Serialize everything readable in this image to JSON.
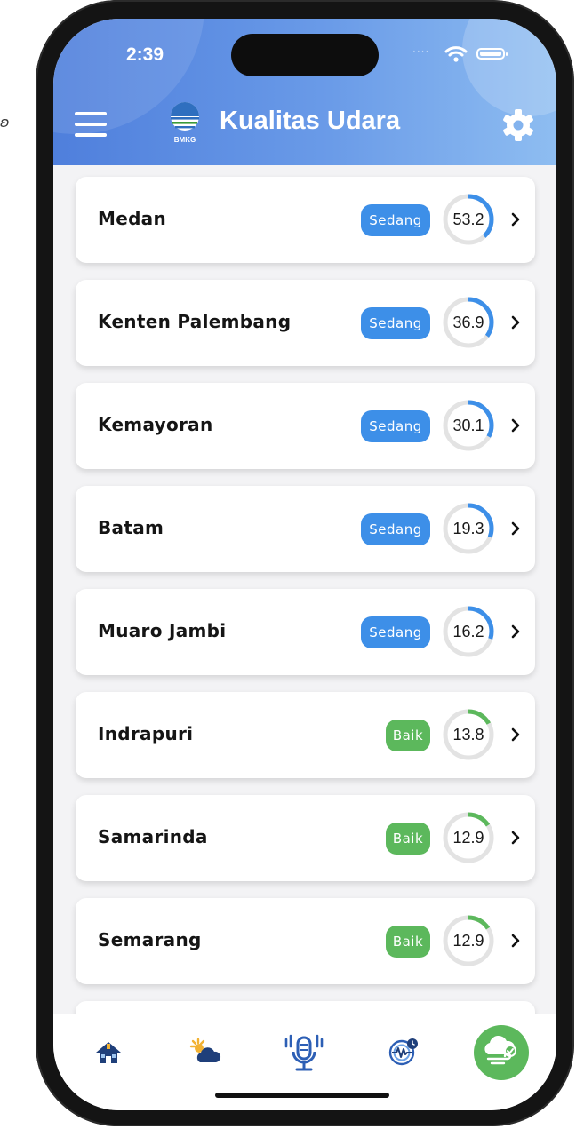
{
  "status_bar": {
    "time": "2:39"
  },
  "header": {
    "title": "Kualitas Udara",
    "logo_text": "BMKG"
  },
  "colors": {
    "sedang": "#3d8fe8",
    "baik": "#5cb85c",
    "ring_track": "#e3e3e3",
    "header_start": "#4f7fdc",
    "header_end": "#8ebdf1"
  },
  "stations": [
    {
      "name": "Medan",
      "status": "Sedang",
      "value": "53.2",
      "ring_fraction": 0.38
    },
    {
      "name": "Kenten Palembang",
      "status": "Sedang",
      "value": "36.9",
      "ring_fraction": 0.35
    },
    {
      "name": "Kemayoran",
      "status": "Sedang",
      "value": "30.1",
      "ring_fraction": 0.33
    },
    {
      "name": "Batam",
      "status": "Sedang",
      "value": "19.3",
      "ring_fraction": 0.31
    },
    {
      "name": "Muaro Jambi",
      "status": "Sedang",
      "value": "16.2",
      "ring_fraction": 0.3
    },
    {
      "name": "Indrapuri",
      "status": "Baik",
      "value": "13.8",
      "ring_fraction": 0.17
    },
    {
      "name": "Samarinda",
      "status": "Baik",
      "value": "12.9",
      "ring_fraction": 0.16
    },
    {
      "name": "Semarang",
      "status": "Baik",
      "value": "12.9",
      "ring_fraction": 0.16
    }
  ],
  "bottom_nav": [
    {
      "icon": "home-icon"
    },
    {
      "icon": "weather-icon"
    },
    {
      "icon": "microphone-icon"
    },
    {
      "icon": "earthquake-icon"
    },
    {
      "icon": "air-quality-icon",
      "active": true
    }
  ]
}
